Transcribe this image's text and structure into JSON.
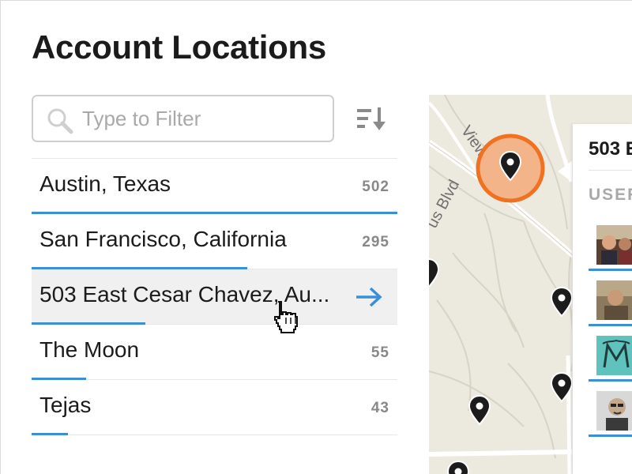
{
  "page": {
    "title": "Account Locations"
  },
  "filter": {
    "placeholder": "Type to Filter",
    "value": ""
  },
  "colors": {
    "accent": "#3b8fd6",
    "marker_orange": "#f07122",
    "map_bg": "#ece9df"
  },
  "icons": {
    "search": "search-icon",
    "sort": "sort-descending-icon",
    "arrow": "arrow-right-icon",
    "cursor": "hand-pointer-icon",
    "pin": "map-pin-icon"
  },
  "locations": [
    {
      "name": "Austin, Texas",
      "count": "502",
      "share": 1.0
    },
    {
      "name": "San Francisco, California",
      "count": "295",
      "share": 0.59
    },
    {
      "name": "503 East Cesar Chavez, Au...",
      "count": "",
      "share": 0.31,
      "hovered": true
    },
    {
      "name": "The Moon",
      "count": "55",
      "share": 0.15
    },
    {
      "name": "Tejas",
      "count": "43",
      "share": 0.1
    }
  ],
  "map": {
    "street_labels": [
      "View Dr",
      "us Blvd"
    ]
  },
  "detail_panel": {
    "title": "503 E",
    "section_header": "USERS"
  }
}
